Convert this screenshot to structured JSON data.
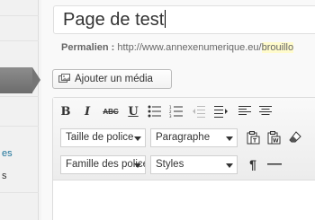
{
  "admin_menu": {
    "items": [
      {
        "label": "es"
      },
      {
        "label": "s"
      }
    ]
  },
  "title": {
    "value": "Page de test"
  },
  "permalink": {
    "label": "Permalien :",
    "url": "http://www.annexenumerique.eu/",
    "slug": "brouillo"
  },
  "media": {
    "label": "Ajouter un média"
  },
  "toolbar": {
    "row1": [
      "bold",
      "italic",
      "strikethrough",
      "underline",
      "bullet-list",
      "numbered-list",
      "outdent",
      "indent",
      "align-left",
      "align-center"
    ],
    "labels": {
      "bold": "B",
      "italic": "I",
      "strike": "ABC",
      "underline": "U"
    },
    "font_size": "Taille de police",
    "paragraph": "Paragraphe",
    "font_family": "Famille des polices",
    "styles": "Styles",
    "pilcrow": "¶"
  }
}
